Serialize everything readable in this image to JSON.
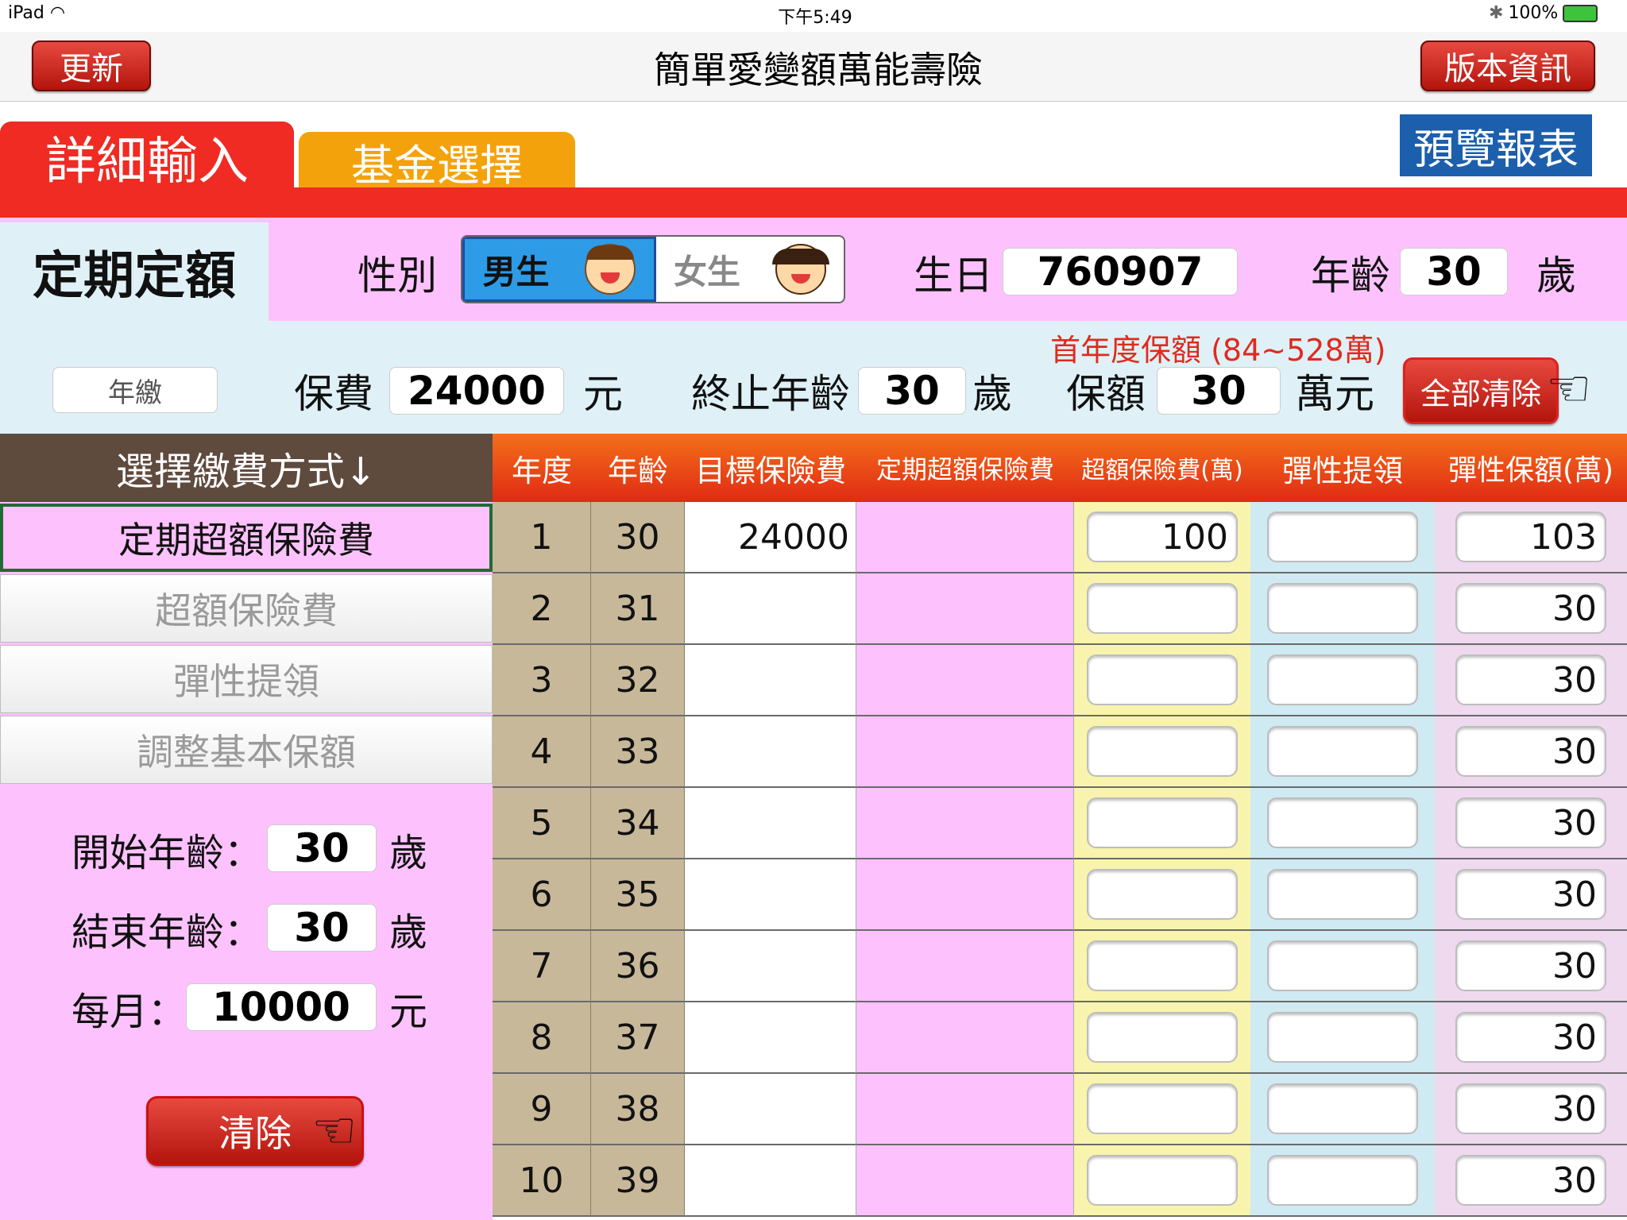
{
  "status_bar": {
    "device": "iPad",
    "time": "下午5:49",
    "battery": "100%"
  },
  "nav": {
    "refresh_label": "更新",
    "title": "簡單愛變額萬能壽險",
    "version_label": "版本資訊"
  },
  "tabs": {
    "detail_input": "詳細輸入",
    "fund_select": "基金選擇"
  },
  "preview_label": "預覽報表",
  "profile": {
    "mode": "定期定額",
    "gender_label": "性別",
    "male": "男生",
    "female": "女生",
    "birthday_label": "生日",
    "birthday": "760907",
    "age_label": "年齡",
    "age": "30",
    "age_unit": "歲"
  },
  "premium": {
    "frequency": "年繳",
    "premium_label": "保費",
    "premium_value": "24000",
    "premium_unit": "元",
    "end_age_label": "終止年齡",
    "end_age_value": "30",
    "end_age_unit": "歲",
    "coverage_hint": "首年度保額 (84~528萬)",
    "coverage_label": "保額",
    "coverage_value": "30",
    "coverage_unit": "萬元",
    "clear_all": "全部清除"
  },
  "payment": {
    "header": "選擇繳費方式↓",
    "options": [
      "定期超額保險費",
      "超額保險費",
      "彈性提領",
      "調整基本保額"
    ],
    "start_age_label": "開始年齡：",
    "start_age": "30",
    "end_age_label": "結束年齡：",
    "end_age": "30",
    "age_unit": "歲",
    "monthly_label": "每月：",
    "monthly": "10000",
    "monthly_unit": "元",
    "clear": "清除"
  },
  "table": {
    "headers": [
      "年度",
      "年齡",
      "目標保險費",
      "定期超額保險費",
      "超額保險費(萬)",
      "彈性提領",
      "彈性保額(萬)"
    ],
    "rows": [
      {
        "year": "1",
        "age": "30",
        "target": "24000",
        "periodic": "",
        "excess": "100",
        "withdraw": "",
        "flex": "103"
      },
      {
        "year": "2",
        "age": "31",
        "target": "",
        "periodic": "",
        "excess": "",
        "withdraw": "",
        "flex": "30"
      },
      {
        "year": "3",
        "age": "32",
        "target": "",
        "periodic": "",
        "excess": "",
        "withdraw": "",
        "flex": "30"
      },
      {
        "year": "4",
        "age": "33",
        "target": "",
        "periodic": "",
        "excess": "",
        "withdraw": "",
        "flex": "30"
      },
      {
        "year": "5",
        "age": "34",
        "target": "",
        "periodic": "",
        "excess": "",
        "withdraw": "",
        "flex": "30"
      },
      {
        "year": "6",
        "age": "35",
        "target": "",
        "periodic": "",
        "excess": "",
        "withdraw": "",
        "flex": "30"
      },
      {
        "year": "7",
        "age": "36",
        "target": "",
        "periodic": "",
        "excess": "",
        "withdraw": "",
        "flex": "30"
      },
      {
        "year": "8",
        "age": "37",
        "target": "",
        "periodic": "",
        "excess": "",
        "withdraw": "",
        "flex": "30"
      },
      {
        "year": "9",
        "age": "38",
        "target": "",
        "periodic": "",
        "excess": "",
        "withdraw": "",
        "flex": "30"
      },
      {
        "year": "10",
        "age": "39",
        "target": "",
        "periodic": "",
        "excess": "",
        "withdraw": "",
        "flex": "30"
      }
    ]
  },
  "colors": {
    "accent_red": "#ef2b24",
    "tab_orange": "#f4a20c",
    "preview_blue": "#1b5fad",
    "pink_bg": "#fdc2fd",
    "light_blue_bg": "#dff1f7"
  }
}
